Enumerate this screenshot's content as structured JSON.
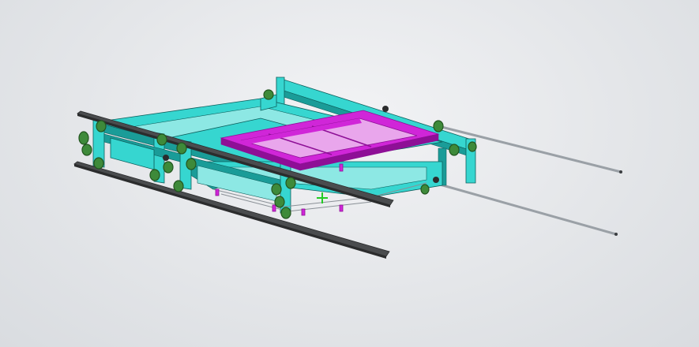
{
  "viewport": {
    "background_top": "#f0f1f3",
    "background_bottom": "#d9dce0"
  },
  "model": {
    "description_type": "cad-3d-assembly",
    "colors": {
      "frame": "#36d6d0",
      "frame_dark": "#1a9c98",
      "frame_edge": "#0d5f5c",
      "tray": "#d026d8",
      "tray_dark": "#8e0f96",
      "rail": "#4a4c4e",
      "rail_dark": "#2b2c2d",
      "wheel": "#3e8a3a",
      "wheel_dark": "#23561f",
      "rod": "#9aa0a6",
      "origin_marker": "#22cc22"
    },
    "icons": [
      "origin-marker-icon"
    ]
  }
}
